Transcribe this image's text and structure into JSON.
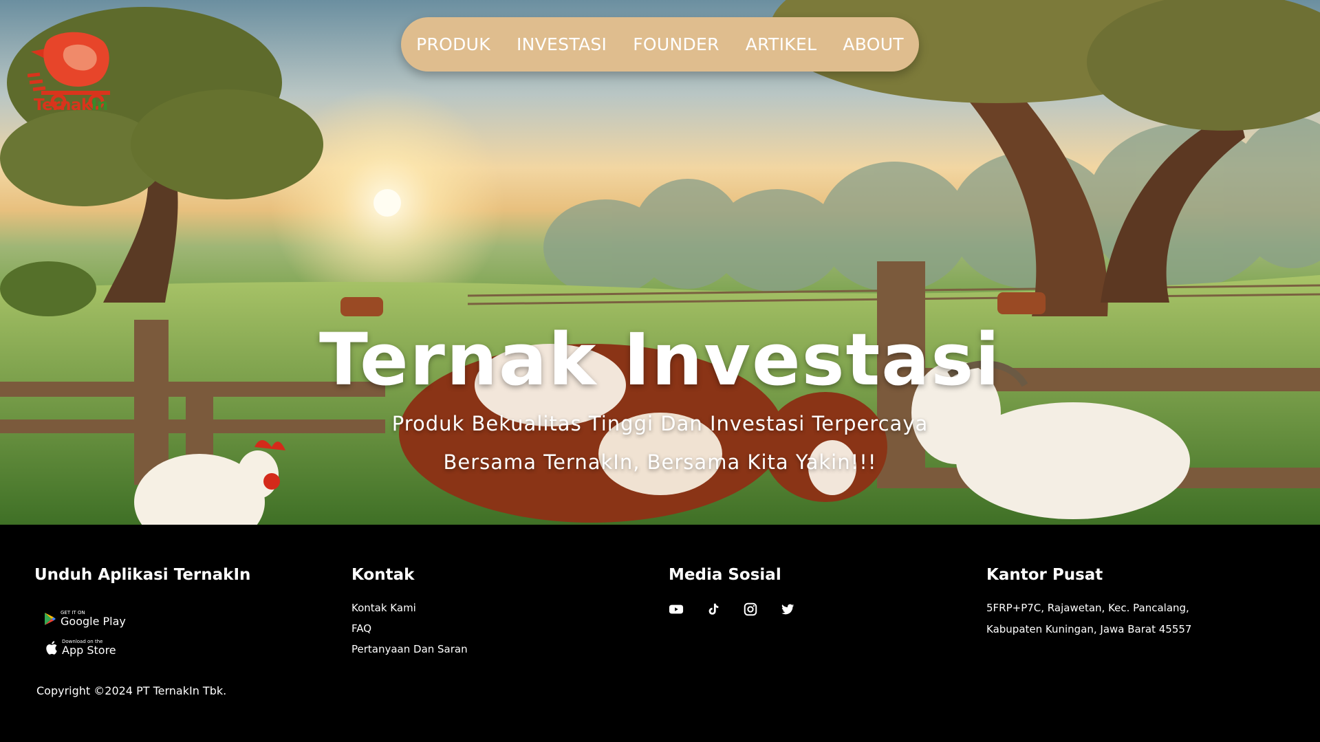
{
  "brand": {
    "name_prefix": "Ternak",
    "name_suffix": "In"
  },
  "nav": {
    "items": [
      "PRODUK",
      "INVESTASI",
      "FOUNDER",
      "ARTIKEL",
      "ABOUT"
    ]
  },
  "hero": {
    "title": "Ternak Investasi",
    "subtitle_line1": "Produk Bekualitas Tinggi Dan Investasi Terpercaya",
    "subtitle_line2": "Bersama TernakIn, Bersama Kita Yakin!!!"
  },
  "footer": {
    "download": {
      "heading": "Unduh Aplikasi TernakIn",
      "google_small": "GET IT ON",
      "google_label": "Google Play",
      "apple_small": "Download on the",
      "apple_label": "App Store"
    },
    "contact": {
      "heading": "Kontak",
      "links": [
        "Kontak Kami",
        "FAQ",
        "Pertanyaan Dan Saran"
      ]
    },
    "social": {
      "heading": "Media Sosial",
      "icons": [
        "youtube-icon",
        "tiktok-icon",
        "instagram-icon",
        "twitter-icon"
      ]
    },
    "office": {
      "heading": "Kantor Pusat",
      "address_line1": "5FRP+P7C, Rajawetan, Kec. Pancalang,",
      "address_line2": "Kabupaten Kuningan, Jawa Barat 45557"
    },
    "copyright": "Copyright ©2024 PT TernakIn Tbk."
  },
  "colors": {
    "nav_bg": "#dfbd8e",
    "footer_bg": "#000000",
    "logo_red": "#d9341c",
    "logo_green": "#3a8a2a"
  }
}
